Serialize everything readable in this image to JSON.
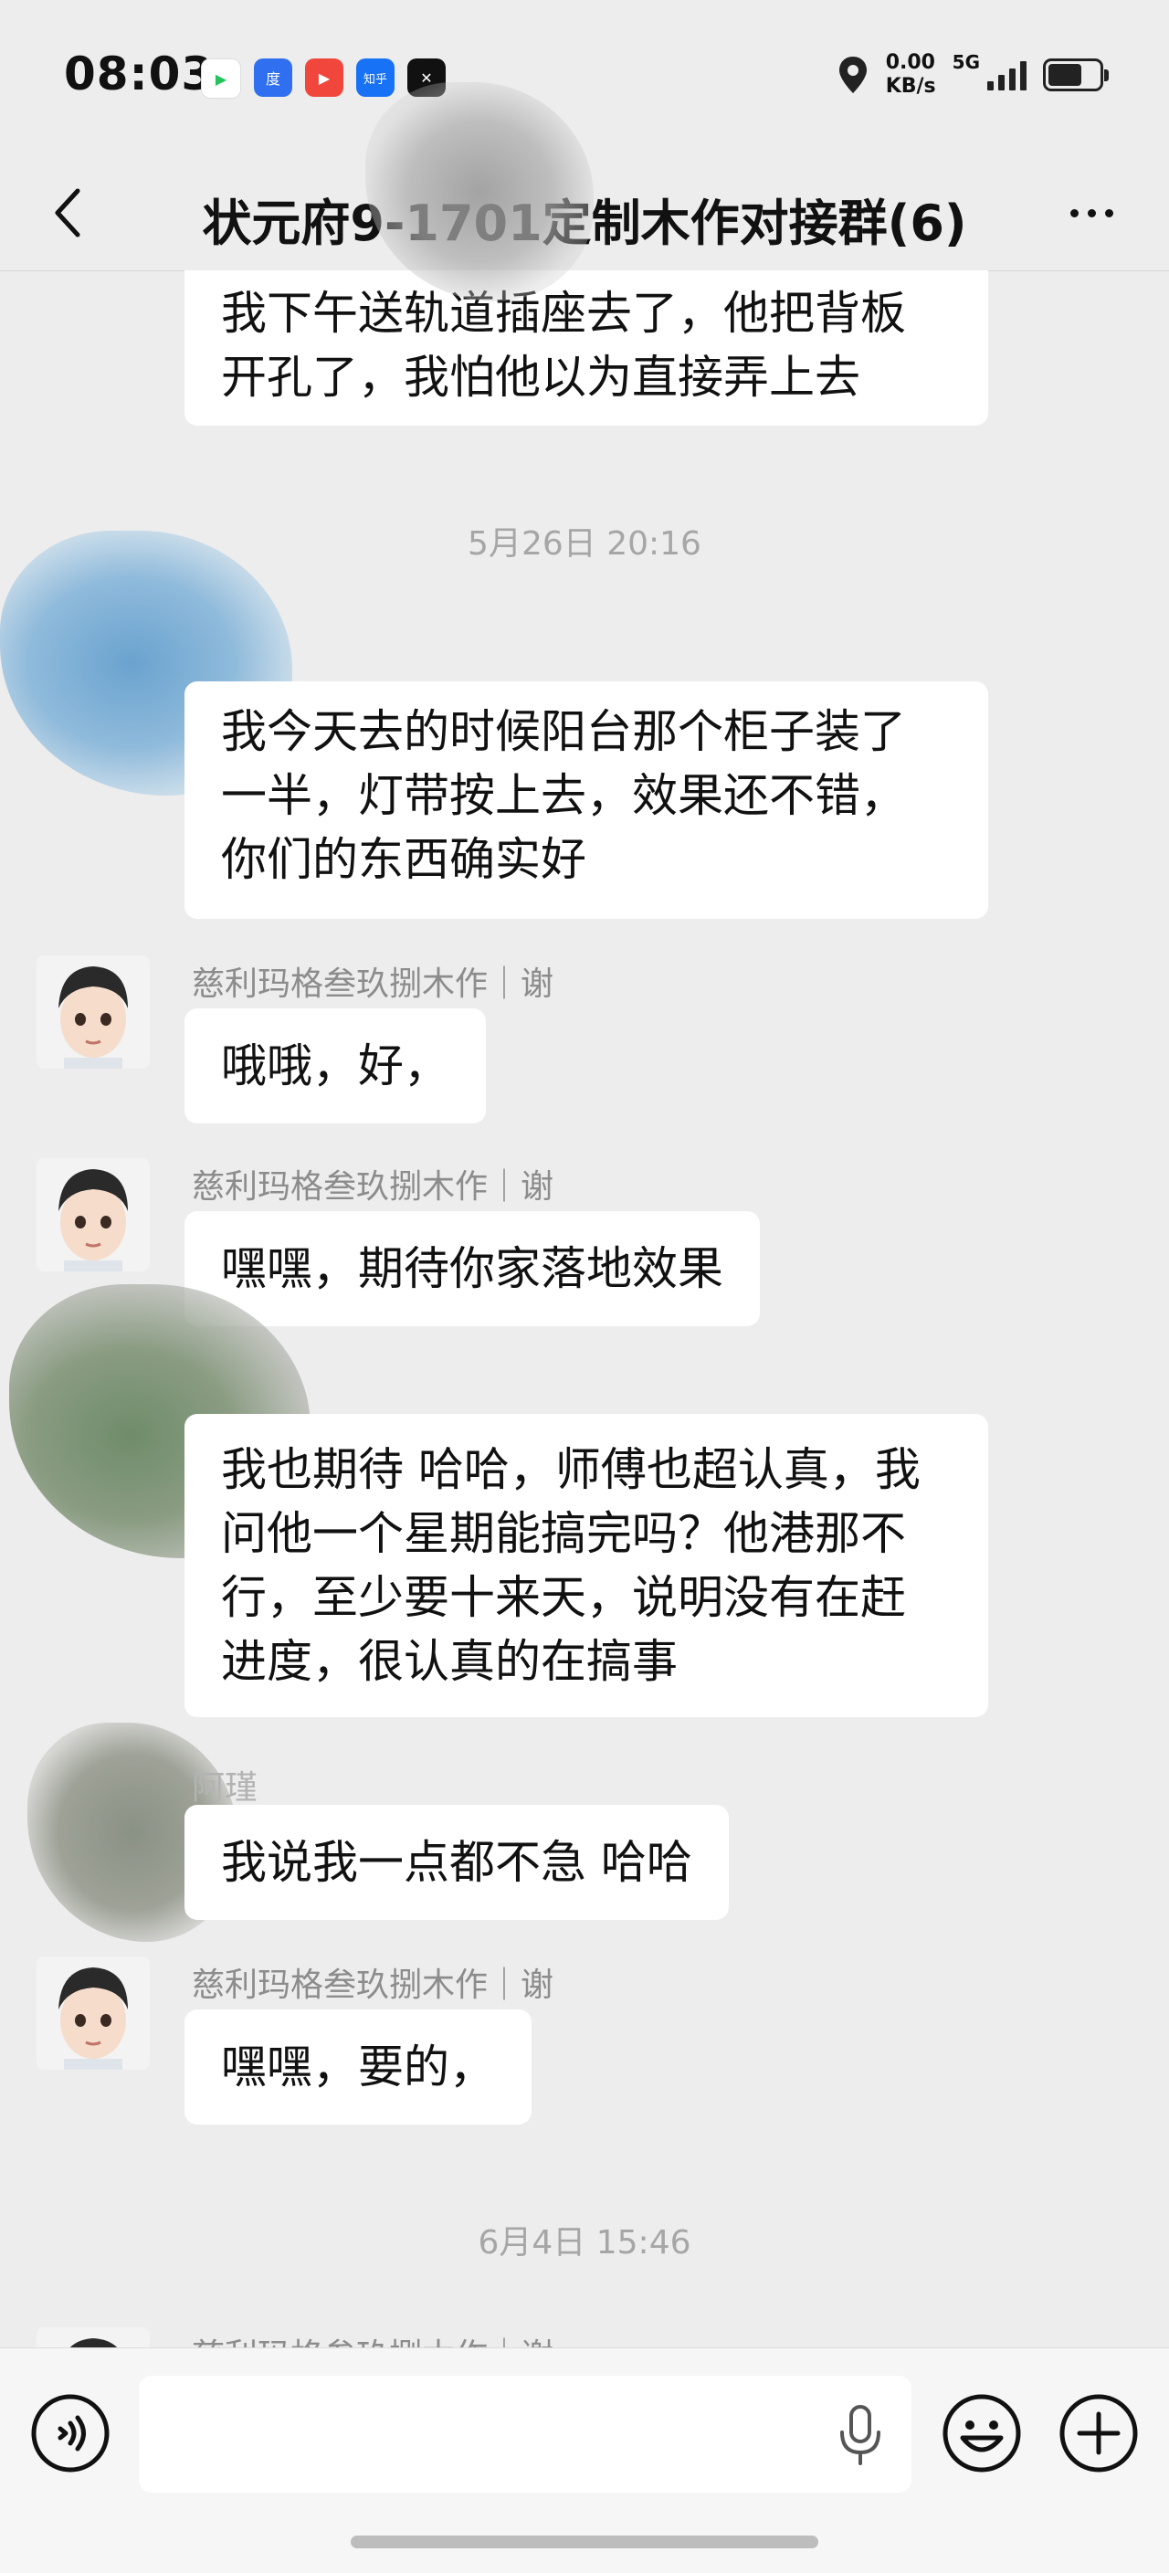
{
  "status_bar": {
    "time": "08:03",
    "net_speed_value": "0.00",
    "net_speed_unit": "KB/s",
    "network_generation": "5G",
    "app_icons": [
      {
        "name": "video-app-icon",
        "color": "#ffffff",
        "glyph": "▶"
      },
      {
        "name": "baidu-app-icon",
        "color": "#2f6ff0",
        "glyph": "度"
      },
      {
        "name": "red-video-app-icon",
        "color": "#f0463c",
        "glyph": "▶"
      },
      {
        "name": "zhihu-app-icon",
        "color": "#1772f6",
        "glyph": "知乎"
      },
      {
        "name": "capcut-app-icon",
        "color": "#111111",
        "glyph": "✕"
      }
    ]
  },
  "header": {
    "title": "状元府9-1701定制木作对接群(6)"
  },
  "messages": [
    {
      "type": "text",
      "text_lines": [
        "我下午送轨道插座去了，他把背板",
        "开孔了，我怕他以为直接弄上去"
      ]
    },
    {
      "type": "time",
      "text": "5月26日 20:16"
    },
    {
      "type": "text",
      "text_lines": [
        "我今天去的时候阳台那个柜子装了",
        "一半，灯带按上去，效果还不错，",
        "你们的东西确实好"
      ]
    },
    {
      "type": "text",
      "sender": "慈利玛格叁玖捌木作｜谢",
      "text_lines": [
        "哦哦，好，"
      ]
    },
    {
      "type": "text",
      "sender": "慈利玛格叁玖捌木作｜谢",
      "text_lines": [
        "嘿嘿，期待你家落地效果"
      ]
    },
    {
      "type": "text",
      "text_lines": [
        "我也期待 哈哈，师傅也超认真，我",
        "问他一个星期能搞完吗？他港那不",
        "行，至少要十来天，说明没有在赶",
        "进度，很认真的在搞事"
      ]
    },
    {
      "type": "text",
      "sender": "阿瑾",
      "text_lines": [
        "我说我一点都不急 哈哈"
      ]
    },
    {
      "type": "text",
      "sender": "慈利玛格叁玖捌木作｜谢",
      "text_lines": [
        "嘿嘿，要的，"
      ]
    },
    {
      "type": "time",
      "text": "6月4日 15:46"
    },
    {
      "type": "text",
      "sender": "慈利玛格叁玖捌木作｜谢",
      "text_lines": []
    }
  ],
  "input": {
    "placeholder": ""
  },
  "colors": {
    "background": "#ededed",
    "bubble": "#ffffff",
    "sender_text": "#8c8c8c",
    "timestamp_text": "#a6a6a6"
  }
}
